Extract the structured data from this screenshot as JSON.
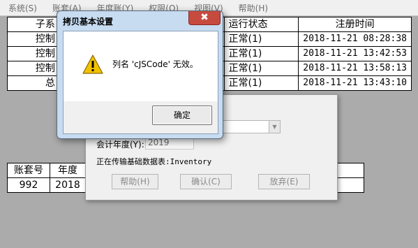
{
  "menu": [
    "系统(S)",
    "账套(A)",
    "年度账(Y)",
    "权限(O)",
    "视图(V)",
    "帮助(H)"
  ],
  "top_table": {
    "headers": [
      "子系",
      "运行状态",
      "注册时间"
    ],
    "rows": [
      [
        "控制",
        "正常(1)",
        "2018-11-21 08:28:38"
      ],
      [
        "控制",
        "正常(1)",
        "2018-11-21 13:42:53"
      ],
      [
        "控制",
        "正常(1)",
        "2018-11-21 13:58:13"
      ],
      [
        "总",
        "正常(1)",
        "2018-11-21 13:43:10"
      ]
    ]
  },
  "bottom_table": {
    "headers": [
      "账套号",
      "年度"
    ],
    "rows": [
      [
        "992",
        "2018"
      ]
    ]
  },
  "background_dialog": {
    "year_label": "会计年度(Y):",
    "year_value": "2019",
    "status_text": "正在传输基础数据表:Inventory",
    "buttons": [
      "帮助(H)",
      "确认(C)",
      "放弃(E)"
    ]
  },
  "dialog": {
    "title": "拷贝基本设置",
    "message": "列名 'cJSCode' 无效。",
    "ok_label": "确定",
    "close_glyph": "✖"
  },
  "colors": {
    "workspace": "#ababab",
    "dialog_frame": "#c7dcf1",
    "close_button": "#c74a3e",
    "warning_yellow": "#f2c200"
  }
}
